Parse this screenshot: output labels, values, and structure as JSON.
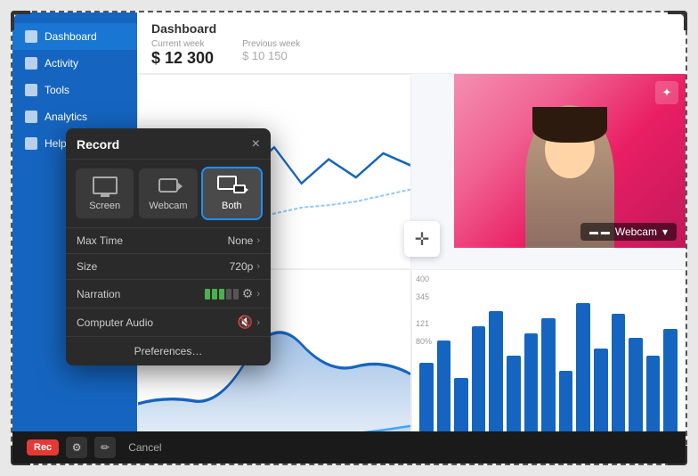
{
  "outer": {
    "title": "Dashboard"
  },
  "sidebar": {
    "items": [
      {
        "label": "Dashboard",
        "active": true
      },
      {
        "label": "Activity",
        "active": false
      },
      {
        "label": "Tools",
        "active": false
      },
      {
        "label": "Analytics",
        "active": false
      },
      {
        "label": "Help",
        "active": false
      }
    ]
  },
  "dashboard": {
    "title": "Dashboard",
    "current_week_label": "Current week",
    "current_week_value": "$ 12 300",
    "prev_week_label": "Previous week",
    "prev_week_value": "$ 10 150"
  },
  "webcam": {
    "label": "Webcam",
    "edit_icon": "✦"
  },
  "record_dialog": {
    "title": "Record",
    "close_label": "×",
    "modes": [
      {
        "id": "screen",
        "label": "Screen",
        "active": false
      },
      {
        "id": "webcam",
        "label": "Webcam",
        "active": false
      },
      {
        "id": "both",
        "label": "Both",
        "active": true
      }
    ],
    "settings": [
      {
        "id": "max-time",
        "label": "Max Time",
        "value": "None"
      },
      {
        "id": "size",
        "label": "Size",
        "value": "720p"
      },
      {
        "id": "narration",
        "label": "Narration",
        "value": ""
      },
      {
        "id": "computer-audio",
        "label": "Computer Audio",
        "value": ""
      }
    ],
    "preferences_label": "Preferences…"
  },
  "toolbar": {
    "rec_label": "Rec",
    "cancel_label": "Cancel"
  },
  "charts": {
    "bars": [
      55,
      70,
      45,
      80,
      90,
      60,
      75,
      85,
      50,
      95,
      65,
      88,
      72,
      60,
      78
    ],
    "y_labels": [
      "400",
      "345",
      "121",
      "80%"
    ],
    "move_icon": "✛"
  }
}
